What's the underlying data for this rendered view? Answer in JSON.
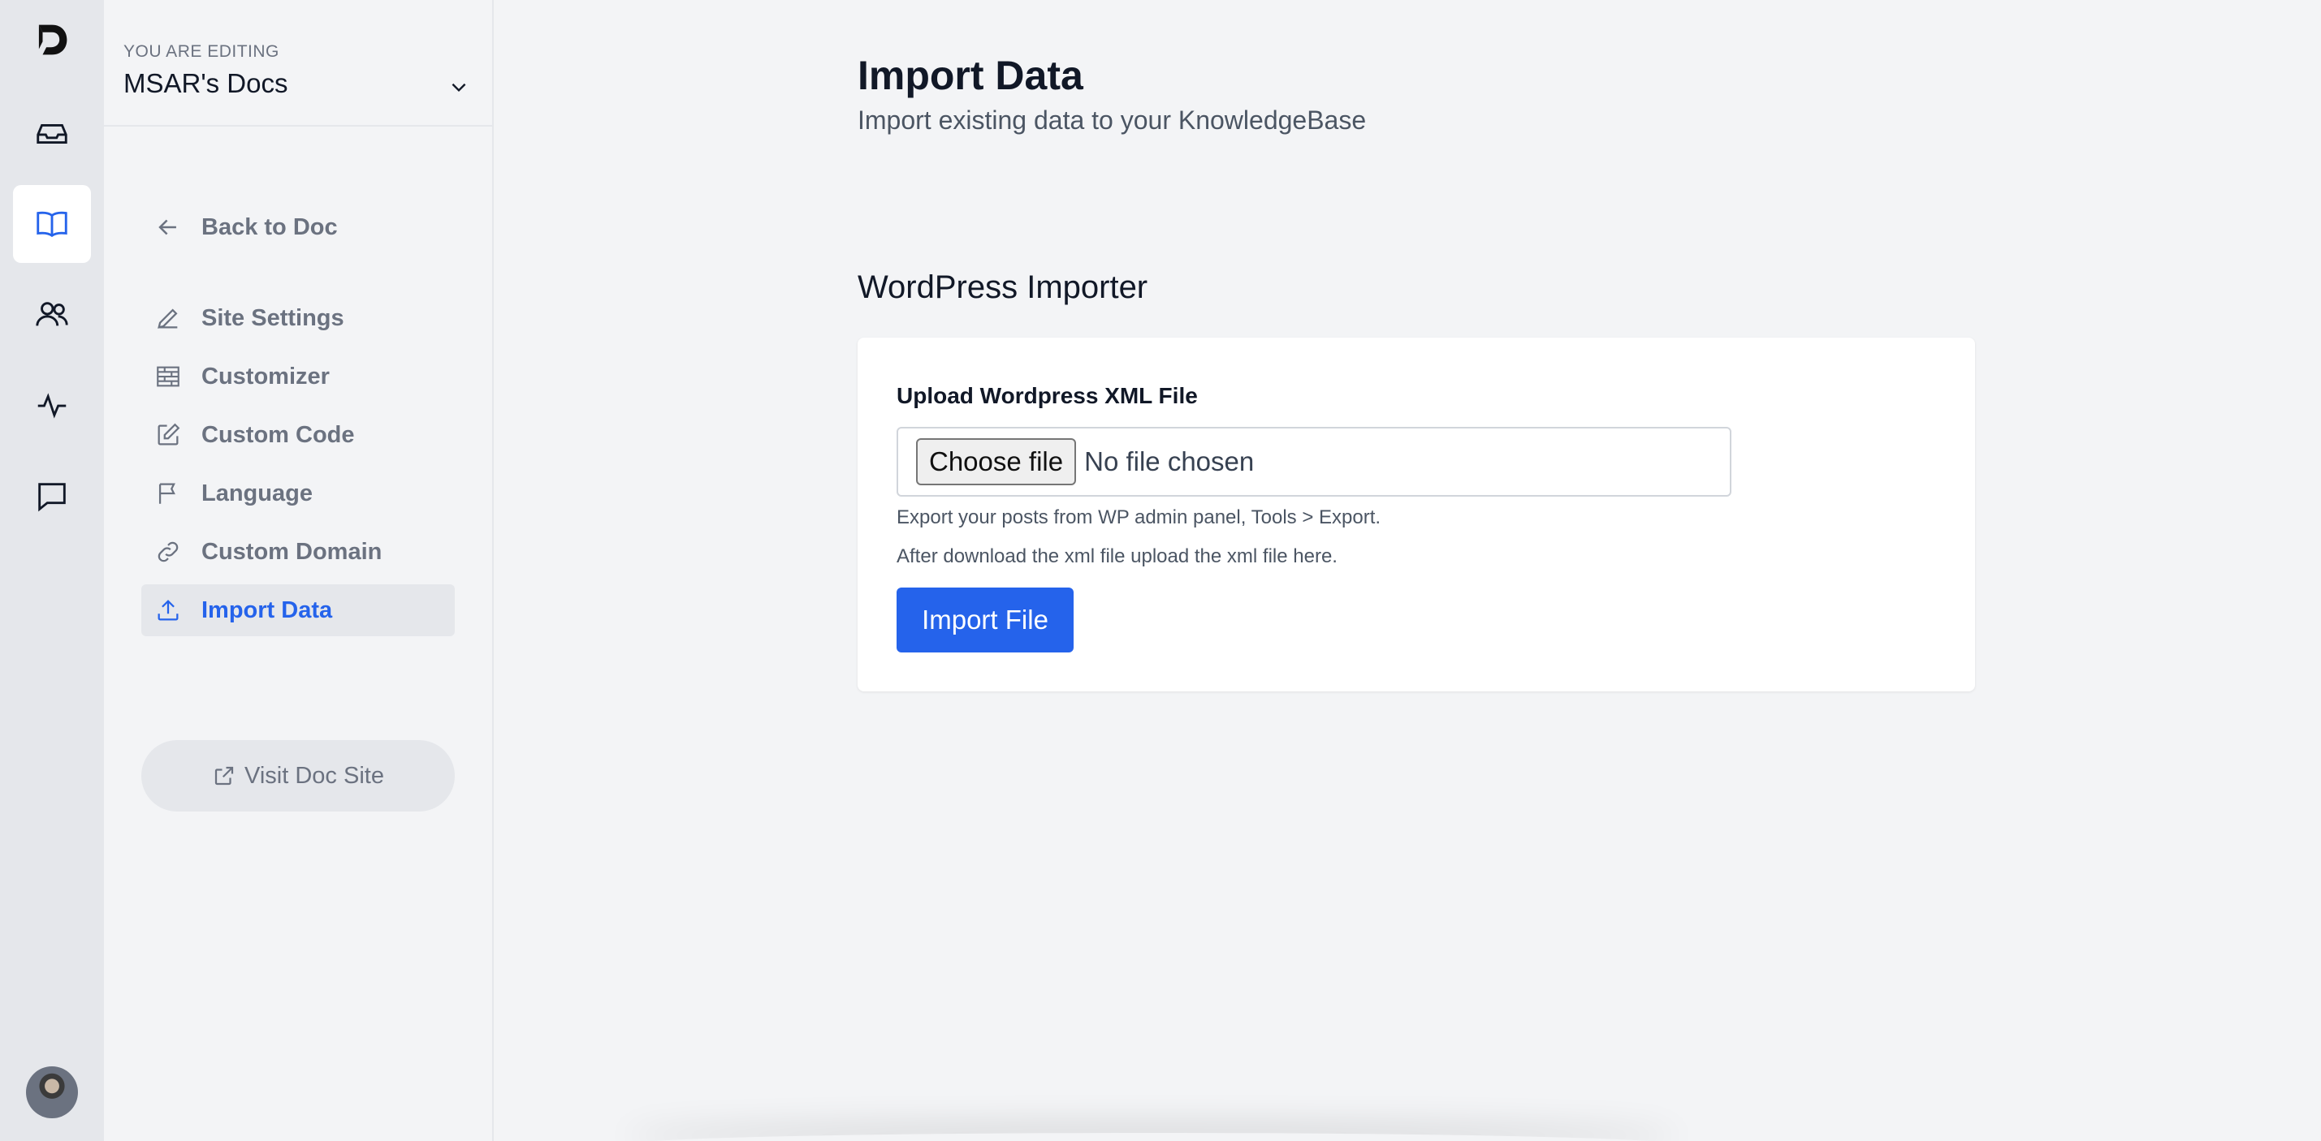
{
  "rail": {
    "items": [
      {
        "icon": "inbox-icon",
        "active": false
      },
      {
        "icon": "book-icon",
        "active": true
      },
      {
        "icon": "users-icon",
        "active": false
      },
      {
        "icon": "activity-icon",
        "active": false
      },
      {
        "icon": "chat-icon",
        "active": false
      }
    ]
  },
  "workspace": {
    "eyebrow": "YOU ARE EDITING",
    "name": "MSAR's Docs"
  },
  "menu": {
    "back": "Back to Doc",
    "items": [
      {
        "label": "Site Settings",
        "icon": "pencil-icon"
      },
      {
        "label": "Customizer",
        "icon": "brick-icon"
      },
      {
        "label": "Custom Code",
        "icon": "edit-icon"
      },
      {
        "label": "Language",
        "icon": "flag-icon"
      },
      {
        "label": "Custom Domain",
        "icon": "link-icon"
      },
      {
        "label": "Import Data",
        "icon": "upload-icon",
        "active": true
      }
    ],
    "visit": "Visit Doc Site"
  },
  "main": {
    "title": "Import Data",
    "subtitle": "Import existing data to your KnowledgeBase",
    "section_title": "WordPress Importer",
    "card": {
      "label": "Upload Wordpress XML File",
      "choose_file": "Choose file",
      "no_file": "No file chosen",
      "hint1": "Export your posts from WP admin panel, Tools > Export.",
      "hint2": "After download the xml file upload the xml file here.",
      "import_button": "Import File"
    }
  },
  "colors": {
    "accent": "#2563eb",
    "sidebar_bg": "#f3f4f6",
    "rail_bg": "#e5e7eb"
  }
}
